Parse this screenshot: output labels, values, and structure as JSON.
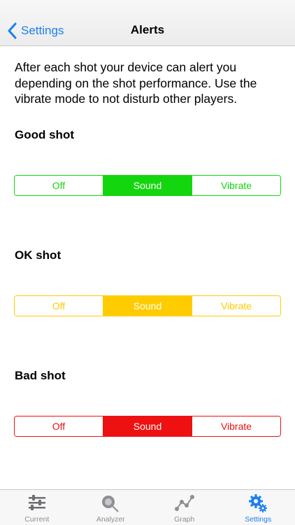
{
  "nav": {
    "back_label": "Settings",
    "title": "Alerts"
  },
  "intro_text": "After each shot your device can alert you depending on the shot performance. Use the vibrate mode to not disturb other players.",
  "sections": [
    {
      "title": "Good shot",
      "color": "#13d60f",
      "options": [
        "Off",
        "Sound",
        "Vibrate"
      ],
      "selected": "Sound"
    },
    {
      "title": "OK shot",
      "color": "#ffcc00",
      "options": [
        "Off",
        "Sound",
        "Vibrate"
      ],
      "selected": "Sound"
    },
    {
      "title": "Bad shot",
      "color": "#ee1111",
      "options": [
        "Off",
        "Sound",
        "Vibrate"
      ],
      "selected": "Sound"
    }
  ],
  "tabbar": {
    "items": [
      {
        "label": "Current",
        "icon": "sliders-icon"
      },
      {
        "label": "Analyzer",
        "icon": "magnifier-icon"
      },
      {
        "label": "Graph",
        "icon": "graph-icon"
      },
      {
        "label": "Settings",
        "icon": "gears-icon"
      }
    ],
    "active": "Settings",
    "accent_color": "#1a7ff0"
  }
}
